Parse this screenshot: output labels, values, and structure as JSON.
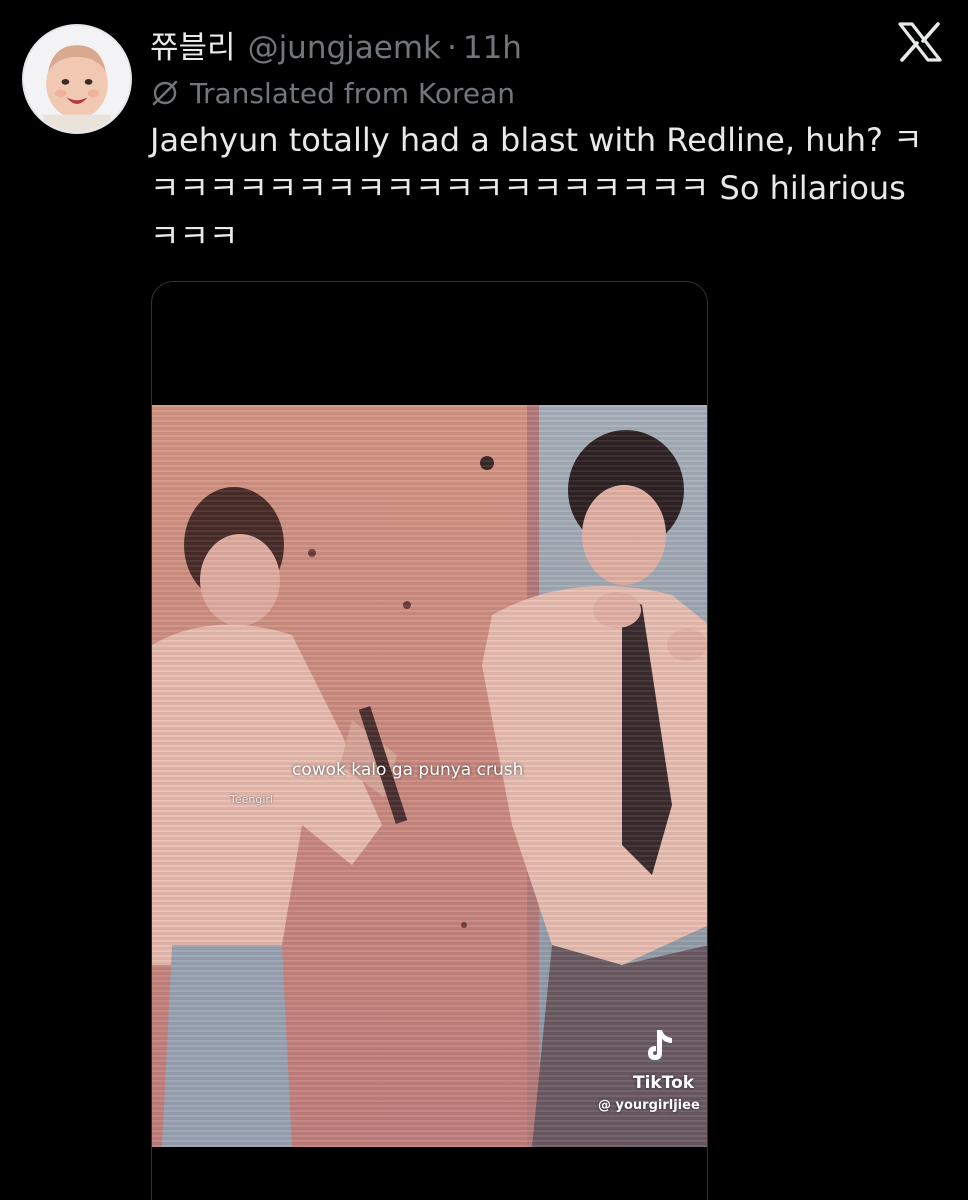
{
  "author": {
    "display_name": "쮸블리",
    "handle": "@jungjaemk",
    "separator": "·",
    "time": "11h",
    "avatar_icon": "baby-avatar-icon"
  },
  "app": {
    "logo_icon": "x-logo-icon"
  },
  "translation": {
    "icon": "translate-icon",
    "label": "Translated from Korean"
  },
  "tweet": {
    "text": "Jaehyun totally had a blast with Redline, huh? ㅋㅋㅋㅋㅋㅋㅋㅋㅋㅋㅋㅋㅋㅋㅋㅋㅋㅋㅋㅋ So hilarious ㅋㅋㅋ"
  },
  "media": {
    "type": "video",
    "caption": "cowok kalo ga punya crush",
    "small_watermark": "Teengirl",
    "tiktok_label": "TikTok",
    "tiktok_user": "@ yourgirljiee",
    "colors": {
      "background_wall": "#c88980",
      "right_wall": "#9da9b5",
      "jacket": "#e6b9ad"
    }
  },
  "theme": {
    "background": "#000000",
    "text": "#e7e9ea",
    "muted": "#71767b",
    "border": "#2f3336"
  }
}
